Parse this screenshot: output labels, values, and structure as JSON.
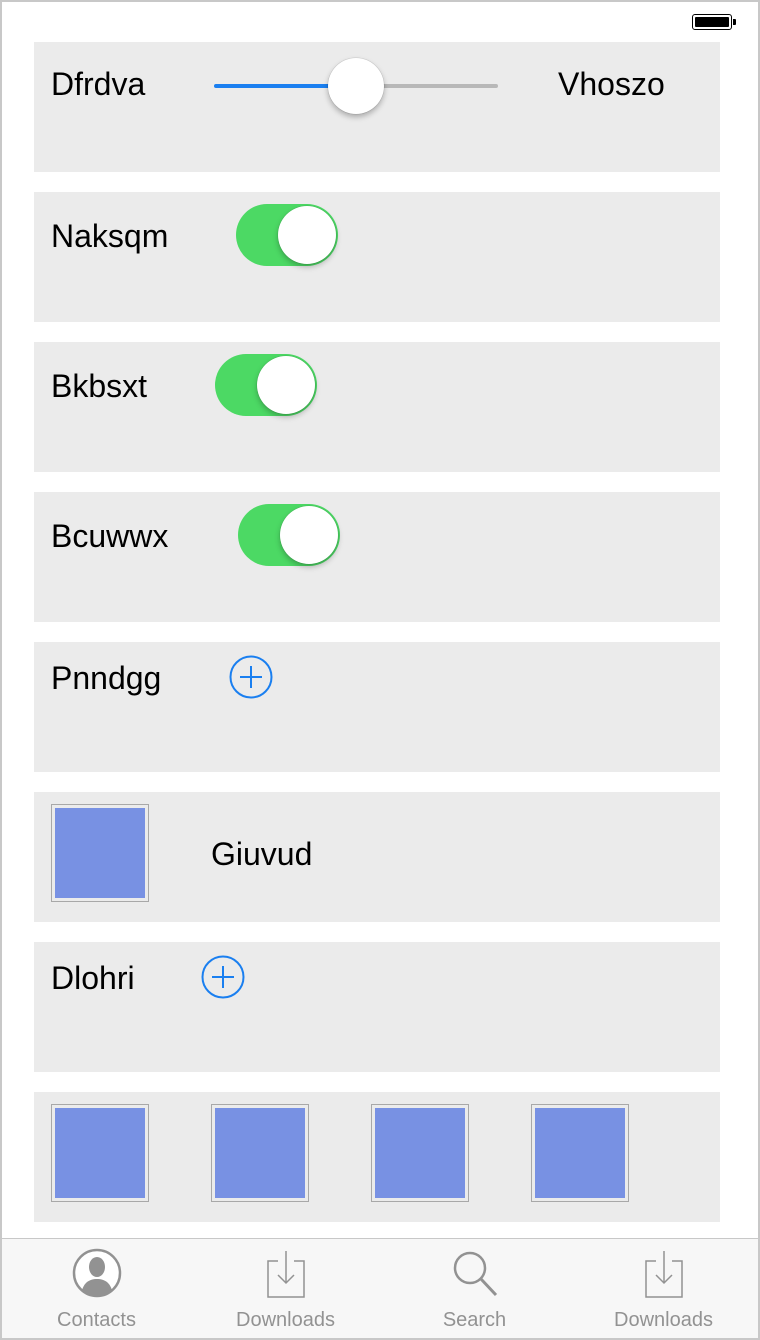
{
  "colors": {
    "row_background": "#ebebeb",
    "slider_active": "#1a7ff0",
    "toggle_on": "#4cd964",
    "accent_blue": "#1a7ff0",
    "image_placeholder": "#7891e3",
    "tab_inactive": "#929292"
  },
  "slider_row": {
    "left_label": "Dfrdva",
    "right_label": "Vhoszo",
    "value_fraction": 0.5
  },
  "toggle_rows": [
    {
      "label": "Naksqm",
      "on": true
    },
    {
      "label": "Bkbsxt",
      "on": true
    },
    {
      "label": "Bcuwwx",
      "on": true
    }
  ],
  "add_rows": [
    {
      "label": "Pnndgg",
      "icon": "plus-circle-icon"
    },
    {
      "label": "Dlohri",
      "icon": "plus-circle-icon"
    }
  ],
  "image_row": {
    "label": "Giuvud"
  },
  "gallery_row": {
    "image_count": 4
  },
  "tabbar": {
    "tabs": [
      {
        "label": "Contacts",
        "icon": "contact-icon"
      },
      {
        "label": "Downloads",
        "icon": "download-icon"
      },
      {
        "label": "Search",
        "icon": "search-icon"
      },
      {
        "label": "Downloads",
        "icon": "download-icon"
      }
    ]
  }
}
